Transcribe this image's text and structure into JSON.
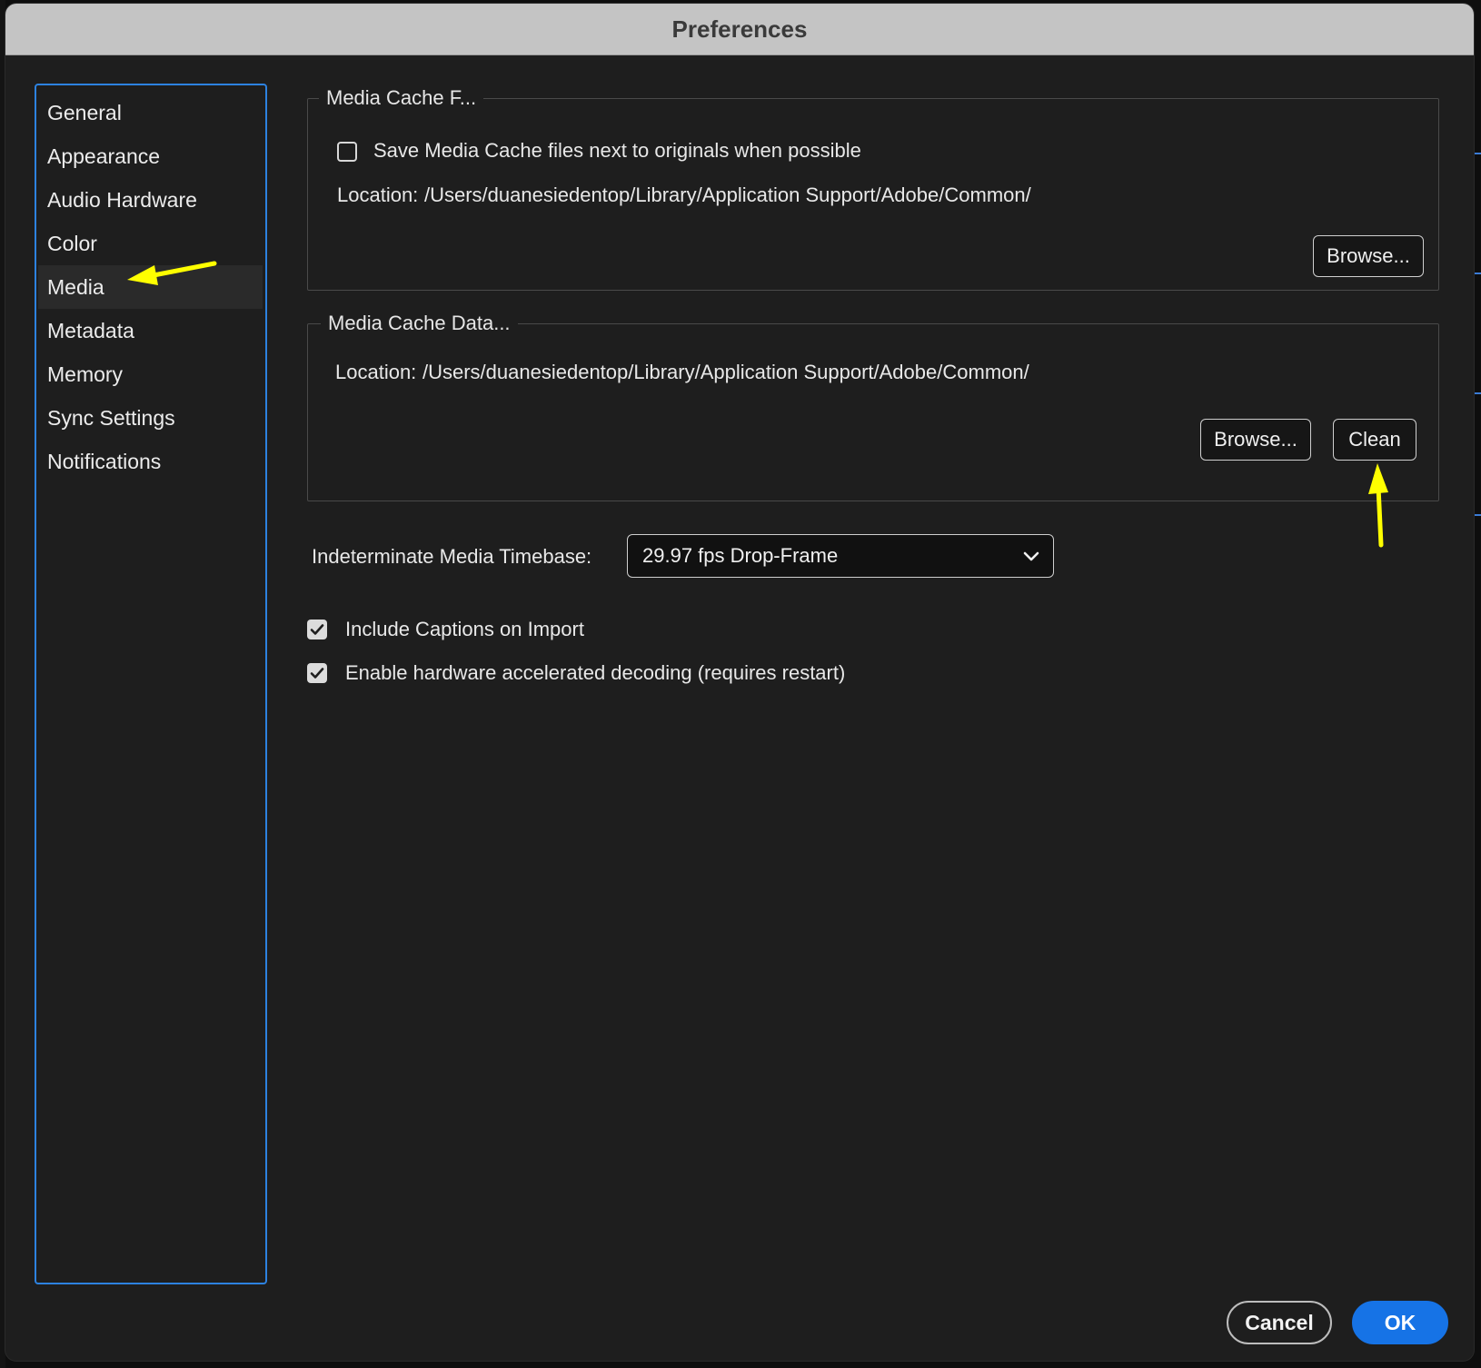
{
  "window": {
    "title": "Preferences"
  },
  "sidebar": {
    "selected": "Media",
    "items": [
      {
        "label": "General"
      },
      {
        "label": "Appearance"
      },
      {
        "label": "Audio Hardware"
      },
      {
        "label": "Color"
      },
      {
        "label": "Media"
      },
      {
        "label": "Metadata"
      },
      {
        "label": "Memory"
      },
      {
        "label": "Sync Settings"
      },
      {
        "label": "Notifications"
      }
    ]
  },
  "media_cache_files": {
    "legend": "Media Cache F...",
    "save_next_to_originals": {
      "label": "Save Media Cache files next to originals when possible",
      "checked": false
    },
    "location_label": "Location:",
    "location_path": "/Users/duanesiedentop/Library/Application Support/Adobe/Common/",
    "browse_label": "Browse..."
  },
  "media_cache_database": {
    "legend": "Media Cache Data...",
    "location_label": "Location:",
    "location_path": "/Users/duanesiedentop/Library/Application Support/Adobe/Common/",
    "browse_label": "Browse...",
    "clean_label": "Clean"
  },
  "timebase": {
    "label": "Indeterminate Media Timebase:",
    "selected": "29.97 fps Drop-Frame"
  },
  "options": {
    "include_captions": {
      "label": "Include Captions on Import",
      "checked": true
    },
    "hardware_decoding": {
      "label": "Enable hardware accelerated decoding (requires restart)",
      "checked": true
    }
  },
  "footer": {
    "cancel_label": "Cancel",
    "ok_label": "OK"
  },
  "annotations": {
    "arrow_color": "#ffff00"
  },
  "colors": {
    "accent": "#2d82e0",
    "ok_button": "#1673e6",
    "background": "#1e1e1e",
    "titlebar": "#c4c4c4"
  }
}
